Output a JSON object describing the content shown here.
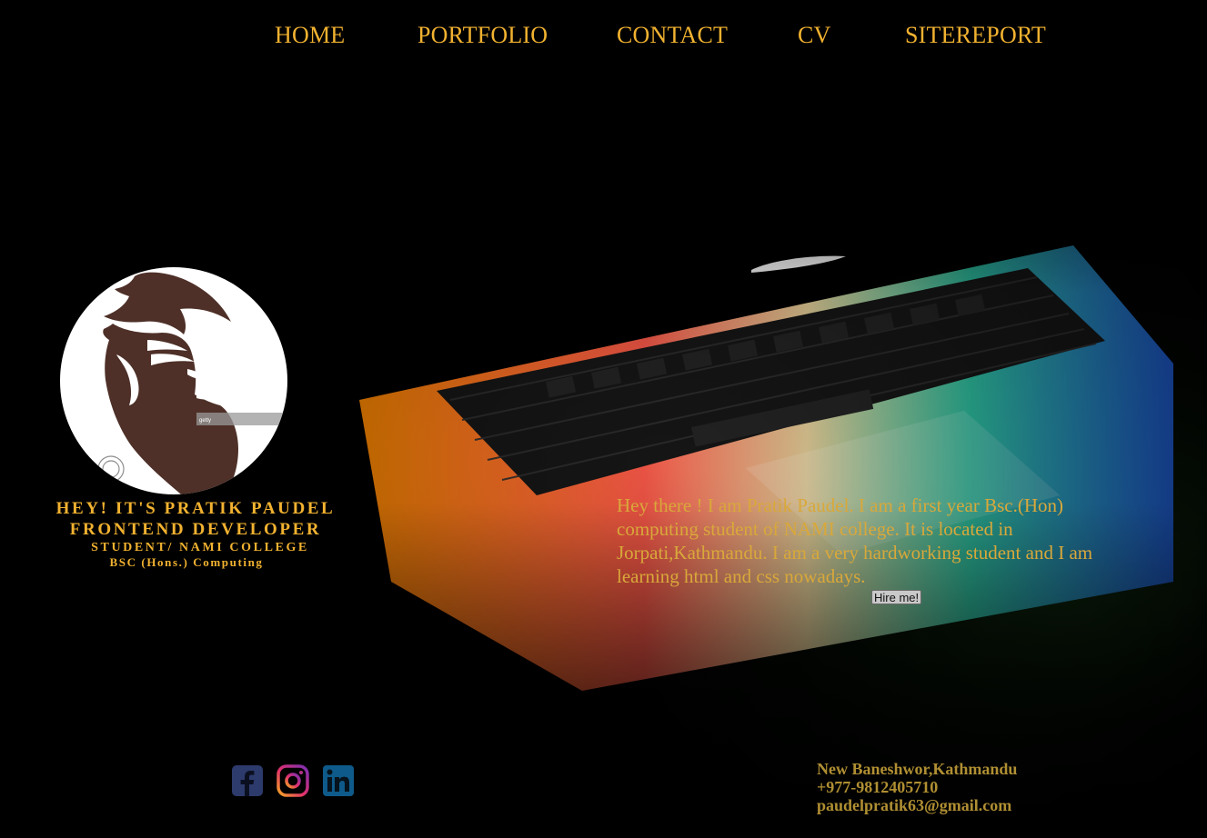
{
  "nav": {
    "items": [
      {
        "label": "HOME"
      },
      {
        "label": "PORTFOLIO"
      },
      {
        "label": "CONTACT"
      },
      {
        "label": "CV"
      },
      {
        "label": "SITEREPORT"
      }
    ]
  },
  "profile": {
    "avatar_icon": "bearded-man-logo-icon",
    "watermark_text": "getty",
    "greeting": "HEY! IT'S PRATIK PAUDEL",
    "role": "FRONTEND DEVELOPER",
    "college": "STUDENT/ NAMI COLLEGE",
    "course": "BSC (Hons.) Computing"
  },
  "about": {
    "text": "Hey there ! I am Pratik Paudel. I am a first year Bsc.(Hon) computing student of NAMI college. It is located in Jorpati,Kathmandu. I am a very hardworking student and I am learning html and css nowadays.",
    "hire_label": "Hire me!"
  },
  "social": {
    "icons": [
      "facebook-icon",
      "instagram-icon",
      "linkedin-icon"
    ]
  },
  "contact": {
    "address": "New Baneshwor,Kathmandu",
    "phone": "+977-9812405710",
    "email": "paudelpratik63@gmail.com"
  },
  "colors": {
    "accent": "#f2b230",
    "background": "#000000"
  }
}
